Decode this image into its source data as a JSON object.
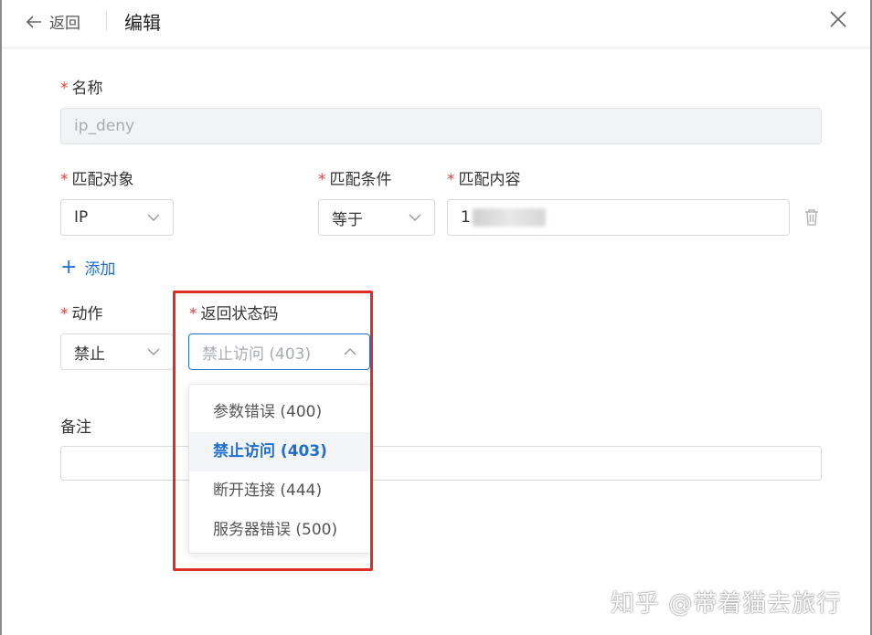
{
  "header": {
    "back_label": "返回",
    "title": "编辑"
  },
  "form": {
    "name": {
      "label": "名称",
      "value": "ip_deny"
    },
    "match_target": {
      "label": "匹配对象",
      "value": "IP"
    },
    "match_condition": {
      "label": "匹配条件",
      "value": "等于"
    },
    "match_content": {
      "label": "匹配内容",
      "value_visible": "1"
    },
    "add_label": "添加",
    "action": {
      "label": "动作",
      "value": "禁止"
    },
    "status_code": {
      "label": "返回状态码",
      "value": "禁止访问 (403)",
      "options": [
        "参数错误 (400)",
        "禁止访问 (403)",
        "断开连接 (444)",
        "服务器错误 (500)"
      ],
      "selected_index": 1
    },
    "remark": {
      "label": "备注",
      "value": ""
    }
  },
  "watermark": "知乎 @带着猫去旅行",
  "colors": {
    "accent": "#1f6fd0",
    "required": "#e0403c",
    "highlight_box": "#e02c25"
  }
}
